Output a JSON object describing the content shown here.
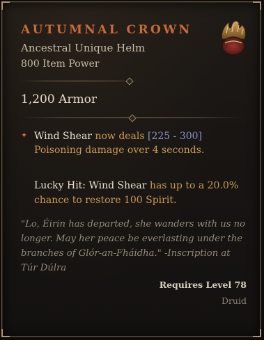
{
  "item": {
    "name": "AUTUMNAL CROWN",
    "type": "Ancestral Unique Helm",
    "item_power": "800 Item Power",
    "icon": "crown-icon"
  },
  "stats": {
    "armor": "1,200 Armor"
  },
  "affix": {
    "bullet_icon": "unique-affix-star-icon",
    "skill": "Wind Shear",
    "text1": " now deals ",
    "range": "[225 - 300]",
    "text2": "Poisoning damage over 4 seconds."
  },
  "lucky_hit": {
    "label": "Lucky Hit:",
    "skill": "Wind Shear",
    "text": "has up to a 20.0% chance to restore 100 Spirit."
  },
  "flavor_text": "\"Lo, Éirin has departed, she wanders with us no longer. May her peace be everlasting under the branches of Glór-an-Fháidha.\" -Inscription at Túr Dúlra",
  "requirements": {
    "level": "Requires Level 78",
    "class": "Druid"
  },
  "colors": {
    "title": "#c96a3a",
    "affix": "#c99a5a",
    "range": "#8d93c9",
    "border": "#6b5a44"
  }
}
